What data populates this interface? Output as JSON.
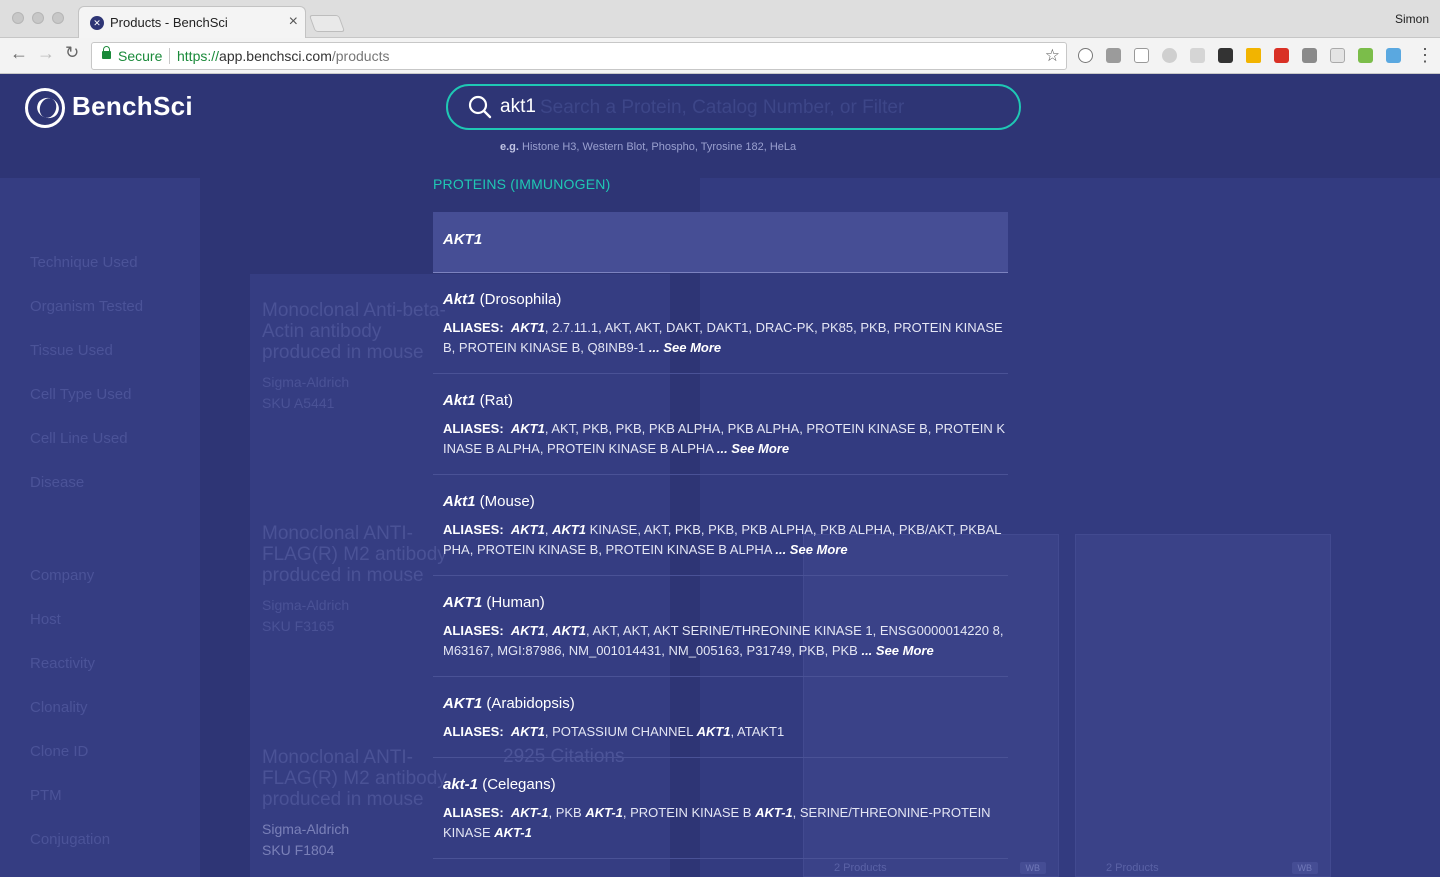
{
  "browser": {
    "tab_title": "Products - BenchSci",
    "tab_close": "×",
    "profile_name": "Simon",
    "secure_label": "Secure",
    "url_scheme": "https://",
    "url_host": "app.benchsci.com",
    "url_path": "/products"
  },
  "app": {
    "logo_text": "BenchSci"
  },
  "search": {
    "value": "akt1",
    "placeholder": "Search a Protein, Catalog Number, or Filter",
    "hint_prefix": "e.g.",
    "hint_text": " Histone H3, Western Blot, Phospho, Tyrosine 182, HeLa"
  },
  "dropdown": {
    "section_title": "PROTEINS (IMMUNOGEN)",
    "aliases_label": "ALIASES:",
    "see_more": "... See More",
    "results": [
      {
        "name": "AKT1",
        "species": ""
      },
      {
        "name": "Akt1",
        "species": " (Drosophila)",
        "hit": "AKT1",
        "aliases": ", 2.7.11.1, AKT, AKT, DAKT, DAKT1, DRAC-PK, PK85, PKB, PROTEIN KINASE B, PROTEIN KINASE B, Q8INB9-1"
      },
      {
        "name": "Akt1",
        "species": " (Rat)",
        "hit": "AKT1",
        "aliases": ", AKT, PKB, PKB, PKB ALPHA, PKB ALPHA, PROTEIN KINASE B, PROTEIN K INASE B ALPHA, PROTEIN KINASE B ALPHA"
      },
      {
        "name": "Akt1",
        "species": " (Mouse)",
        "hit": "AKT1",
        "hit2": "AKT1",
        "aliases": " KINASE, AKT, PKB, PKB, PKB ALPHA, PKB ALPHA, PKB/AKT, PKBAL PHA, PROTEIN KINASE B, PROTEIN KINASE B ALPHA"
      },
      {
        "name": "AKT1",
        "species": " (Human)",
        "hit": "AKT1",
        "hit2": "AKT1",
        "aliases": ", AKT, AKT, AKT SERINE/THREONINE KINASE 1, ENSG0000014220 8, M63167, MGI:87986, NM_001014431, NM_005163, P31749, PKB, PKB"
      },
      {
        "name": "AKT1",
        "species": " (Arabidopsis)",
        "hit": "AKT1",
        "mid": ", POTASSIUM CHANNEL ",
        "hit2": "AKT1",
        "tail": ", ATAKT1"
      },
      {
        "name": "akt-1",
        "species": " (Celegans)",
        "hit": "AKT-1",
        "p1": ", PKB ",
        "hit2": "AKT-1",
        "p2": ", PROTEIN KINASE B ",
        "hit3": "AKT-1",
        "p3": ", SERINE/THREONINE-PROTEIN KINASE ",
        "hit4": "AKT-1"
      }
    ]
  },
  "background": {
    "sidebar_items": [
      "Technique Used",
      "Organism Tested",
      "Tissue Used",
      "Cell Type Used",
      "Cell Line Used",
      "Disease",
      "Company",
      "Host",
      "Reactivity",
      "Clonality",
      "Clone ID",
      "PTM",
      "Conjugation"
    ],
    "card_titles": [
      "Monoclonal Anti-beta-Actin antibody produced in mouse",
      "Monoclonal ANTI-FLAG(R) M2 antibody produced in mouse",
      "Monoclonal ANTI-FLAG(R) M2 antibody produced in mouse"
    ],
    "card_vendor": "Sigma-Aldrich",
    "card_skus": [
      "SKU A5441",
      "SKU F3165",
      "SKU F1804"
    ],
    "citations_text": "2925 Citations",
    "figure_caption": "2 Products",
    "figure_badge": "WB"
  }
}
